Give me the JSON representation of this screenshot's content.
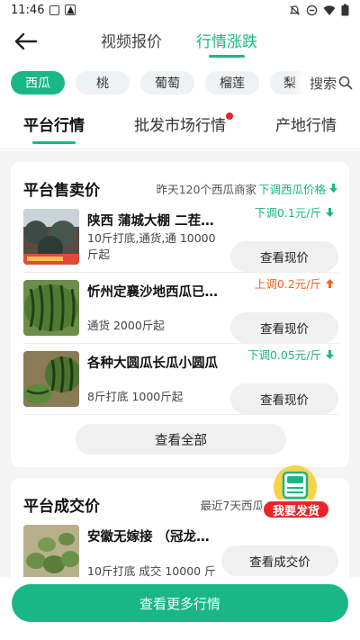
{
  "status_bar": {
    "time": "11:46"
  },
  "nav": {
    "tabs": [
      {
        "label": "视频报价"
      },
      {
        "label": "行情涨跌"
      }
    ]
  },
  "chips": [
    "西瓜",
    "桃",
    "葡萄",
    "榴莲",
    "梨"
  ],
  "search": {
    "label": "搜索"
  },
  "sub_tabs": [
    "平台行情",
    "批发市场行情",
    "产地行情"
  ],
  "sale_card": {
    "title": "平台售卖价",
    "subtitle": "昨天120个西瓜商家",
    "subtitle_action": "下调西瓜价格",
    "items": [
      {
        "name": "陕西 蒲城大棚 二茬…",
        "desc": "10斤打底,通货,通 10000斤起",
        "trend": "下调0.1元/斤",
        "trend_dir": "down",
        "button": "查看现价"
      },
      {
        "name": "忻州定襄沙地西瓜已…",
        "desc": "通货 2000斤起",
        "trend": "上调0.2元/斤",
        "trend_dir": "up",
        "button": "查看现价"
      },
      {
        "name": "各种大圆瓜长瓜小圆瓜",
        "desc": "8斤打底 1000斤起",
        "trend": "下调0.05元/斤",
        "trend_dir": "down",
        "button": "查看现价"
      }
    ],
    "view_all": "查看全部"
  },
  "deal_card": {
    "title": "平台成交价",
    "subtitle": "最近7天西瓜成交",
    "items": [
      {
        "name": "安徽无嫁接 （冠龙）…",
        "desc": "10斤打底 成交 10000 斤",
        "button": "查看成交价"
      }
    ]
  },
  "float_badge": {
    "label": "我要发货"
  },
  "cta": {
    "label": "查看更多行情"
  },
  "colors": {
    "accent": "#19b785",
    "up": "#f06421",
    "badge_red": "#e8252b"
  }
}
